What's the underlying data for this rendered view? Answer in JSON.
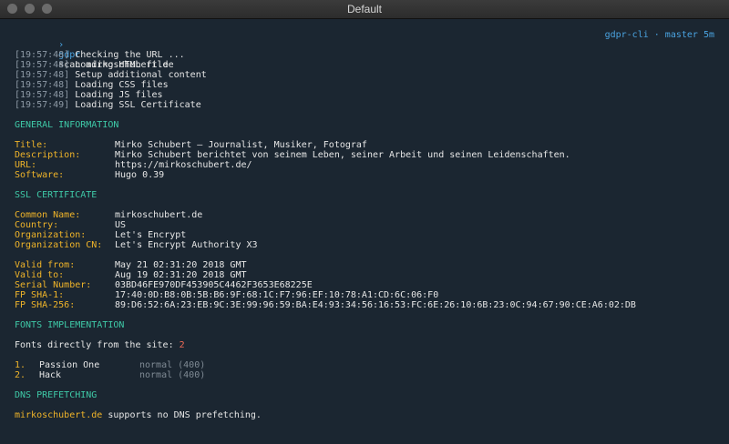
{
  "window": {
    "title": "Default"
  },
  "prompt": {
    "arrow": "›",
    "command_name": "gdpr",
    "command_args": "scan mirkoschubert.de",
    "right_info": "gdpr-cli · master 5m"
  },
  "log": [
    {
      "time": "[19:57:48]",
      "text": "Checking the URL ..."
    },
    {
      "time": "[19:57:48]",
      "text": "Loading HTML file"
    },
    {
      "time": "[19:57:48]",
      "text": "Setup additional content"
    },
    {
      "time": "[19:57:48]",
      "text": "Loading CSS files"
    },
    {
      "time": "[19:57:48]",
      "text": "Loading JS files"
    },
    {
      "time": "[19:57:49]",
      "text": "Loading SSL Certificate"
    }
  ],
  "general": {
    "heading": "GENERAL INFORMATION",
    "rows": [
      {
        "key": "Title:",
        "value": "Mirko Schubert – Journalist, Musiker, Fotograf"
      },
      {
        "key": "Description:",
        "value": "Mirko Schubert berichtet von seinem Leben, seiner Arbeit und seinen Leidenschaften."
      },
      {
        "key": "URL:",
        "value": "https://mirkoschubert.de/"
      },
      {
        "key": "Software:",
        "value": "Hugo 0.39"
      }
    ]
  },
  "ssl": {
    "heading": "SSL CERTIFICATE",
    "rows": [
      {
        "key": "Common Name:",
        "value": "mirkoschubert.de"
      },
      {
        "key": "Country:",
        "value": "US"
      },
      {
        "key": "Organization:",
        "value": "Let's Encrypt"
      },
      {
        "key": "Organization CN:",
        "value": "Let's Encrypt Authority X3"
      }
    ],
    "validity_rows": [
      {
        "key": "Valid from:",
        "value": "May 21 02:31:20 2018 GMT"
      },
      {
        "key": "Valid to:",
        "value": "Aug 19 02:31:20 2018 GMT"
      },
      {
        "key": "Serial Number:",
        "value": "03BD46FE970DF453905C4462F3653E68225E"
      },
      {
        "key": "FP SHA-1:",
        "value": "17:40:0D:B8:0B:5B:B6:9F:68:1C:F7:96:EF:10:78:A1:CD:6C:06:F0"
      },
      {
        "key": "FP SHA-256:",
        "value": "89:D6:52:6A:23:EB:9C:3E:99:96:59:BA:E4:93:34:56:16:53:FC:6E:26:10:6B:23:0C:94:67:90:CE:A6:02:DB"
      }
    ]
  },
  "fonts": {
    "heading": "FONTS IMPLEMENTATION",
    "summary_label": "Fonts directly from the site:",
    "count": "2",
    "items": [
      {
        "num": "1.",
        "name": "Passion One",
        "weight": "normal (400)"
      },
      {
        "num": "2.",
        "name": "Hack",
        "weight": "normal (400)"
      }
    ]
  },
  "dns": {
    "heading": "DNS PREFETCHING",
    "domain": "mirkoschubert.de",
    "message": "supports no DNS prefetching."
  }
}
